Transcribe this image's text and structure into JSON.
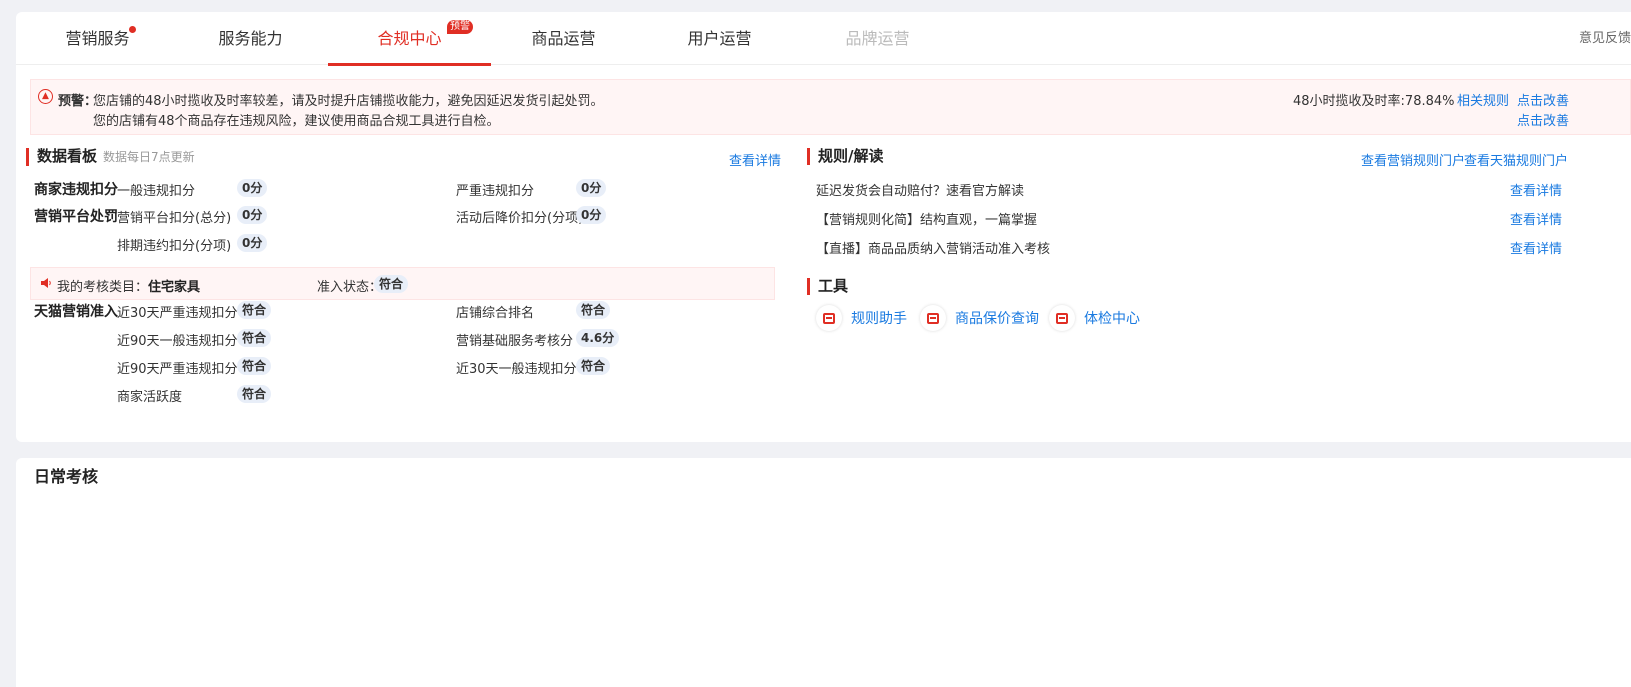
{
  "tabs": [
    {
      "label": "营销服务",
      "state": "normal",
      "marker": "dot"
    },
    {
      "label": "服务能力",
      "state": "normal"
    },
    {
      "label": "合规中心",
      "state": "active",
      "badge": "预警"
    },
    {
      "label": "商品运营",
      "state": "normal"
    },
    {
      "label": "用户运营",
      "state": "normal"
    },
    {
      "label": "品牌运营",
      "state": "disabled"
    }
  ],
  "feedback": "意见反馈",
  "warning": {
    "title": "预警：",
    "line1": "您店铺的48小时揽收及时率较差，请及时提升店铺揽收能力，避免因延迟发货引起处罚。",
    "line2": "您的店铺有48个商品存在违规风险，建议使用商品合规工具进行自检。",
    "rate": "48小时揽收及时率:78.84%",
    "rule_link": "相关规则",
    "fix_link1": "点击改善",
    "fix_link2": "点击改善"
  },
  "dashboard": {
    "title": "数据看板",
    "subtitle": "数据每日7点更新",
    "detail_link": "查看详情",
    "merchant": {
      "category": "商家违规扣分",
      "items": [
        {
          "label": "一般违规扣分",
          "value": "0分"
        },
        {
          "label": "严重违规扣分",
          "value": "0分"
        }
      ]
    },
    "platform": {
      "category": "营销平台处罚",
      "items": [
        {
          "label": "营销平台扣分(总分)",
          "value": "0分"
        },
        {
          "label": "活动后降价扣分(分项)",
          "value": "0分"
        },
        {
          "label": "排期违约扣分(分项)",
          "value": "0分"
        }
      ]
    },
    "assessment": {
      "label": "我的考核类目：",
      "category": "住宅家具",
      "status_label": "准入状态：",
      "status": "符合"
    },
    "tmall": {
      "category": "天猫营销准入",
      "items": [
        {
          "label": "近30天严重违规扣分",
          "value": "符合"
        },
        {
          "label": "店铺综合排名",
          "value": "符合"
        },
        {
          "label": "近90天一般违规扣分",
          "value": "符合"
        },
        {
          "label": "营销基础服务考核分",
          "value": "4.6分"
        },
        {
          "label": "近90天严重违规扣分",
          "value": "符合"
        },
        {
          "label": "近30天一般违规扣分",
          "value": "符合"
        },
        {
          "label": "商家活跃度",
          "value": "符合"
        }
      ]
    }
  },
  "rules": {
    "title": "规则/解读",
    "portal_link1": "查看营销规则门户",
    "portal_link2": "查看天猫规则门户",
    "items": [
      {
        "text": "延迟发货会自动赔付？速看官方解读",
        "link": "查看详情"
      },
      {
        "text": "【营销规则化简】结构直观，一篇掌握",
        "link": "查看详情"
      },
      {
        "text": "【直播】商品品质纳入营销活动准入考核",
        "link": "查看详情"
      }
    ]
  },
  "tools": {
    "title": "工具",
    "items": [
      "规则助手",
      "商品保价查询",
      "体检中心"
    ]
  },
  "daily": {
    "title": "日常考核"
  },
  "colors": {
    "accent": "#e02e24",
    "link": "#1a7ae0"
  }
}
